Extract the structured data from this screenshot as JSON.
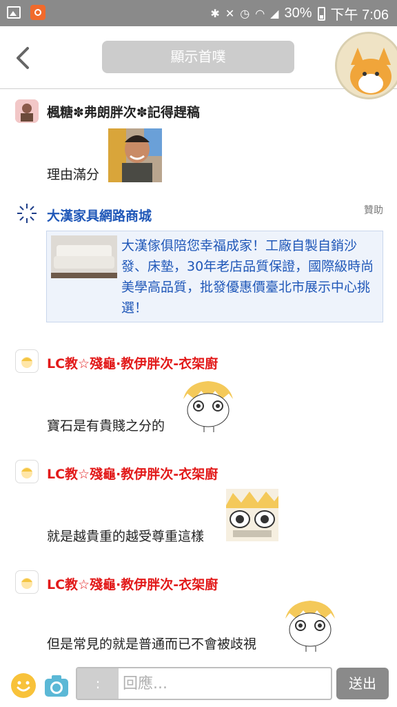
{
  "status_bar": {
    "battery": "30%",
    "time": "下午 7:06",
    "icons": [
      "gallery-icon",
      "app-icon",
      "bluetooth-icon",
      "mute-icon",
      "alarm-icon",
      "wifi-icon",
      "signal-icon",
      "battery-icon"
    ]
  },
  "header": {
    "home_label": "顯示首噗",
    "back_icon": "chevron-left-icon"
  },
  "posts": [
    {
      "username": "楓糖✽弗朗胖次✽記得趕稿",
      "message": "理由滿分",
      "color": "#222222"
    },
    {
      "username": "大漢家具網路商城",
      "sponsor_label": "贊助",
      "ad_text": "大漢傢俱陪您幸福成家！工廠自製自銷沙發、床墊，30年老店品質保證，國際級時尚美學高品質，批發優惠價臺北市展示中心挑選！",
      "color": "#1f57b8"
    },
    {
      "username": "LC教☆殘龜·教伊胖次-衣架廚",
      "message": "寶石是有貴賤之分的",
      "color": "#e21a1a"
    },
    {
      "username": "LC教☆殘龜·教伊胖次-衣架廚",
      "message": "就是越貴重的越受尊重這樣",
      "color": "#e21a1a"
    },
    {
      "username": "LC教☆殘龜·教伊胖次-衣架廚",
      "message": "但是常見的就是普通而已不會被歧視",
      "color": "#e21a1a"
    }
  ],
  "reply_bar": {
    "colon_label": ":",
    "placeholder": "回應...",
    "send_label": "送出"
  }
}
